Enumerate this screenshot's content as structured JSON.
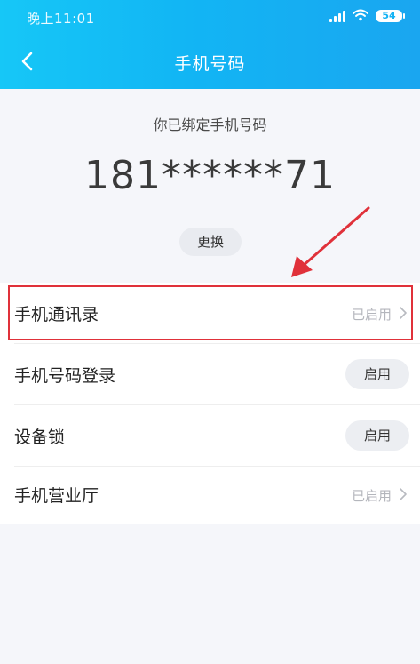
{
  "status_bar": {
    "time": "晚上11:01",
    "battery": "54"
  },
  "nav": {
    "title": "手机号码"
  },
  "hero": {
    "caption": "你已绑定手机号码",
    "phone_number": "181******71",
    "change_label": "更换"
  },
  "settings": [
    {
      "label": "手机通讯录",
      "status": "已启用",
      "action": "chevron"
    },
    {
      "label": "手机号码登录",
      "button": "启用"
    },
    {
      "label": "设备锁",
      "button": "启用"
    },
    {
      "label": "手机营业厅",
      "status": "已启用",
      "action": "chevron"
    }
  ],
  "colors": {
    "header_accent": "#12b5f4",
    "highlight": "#e0313a"
  }
}
